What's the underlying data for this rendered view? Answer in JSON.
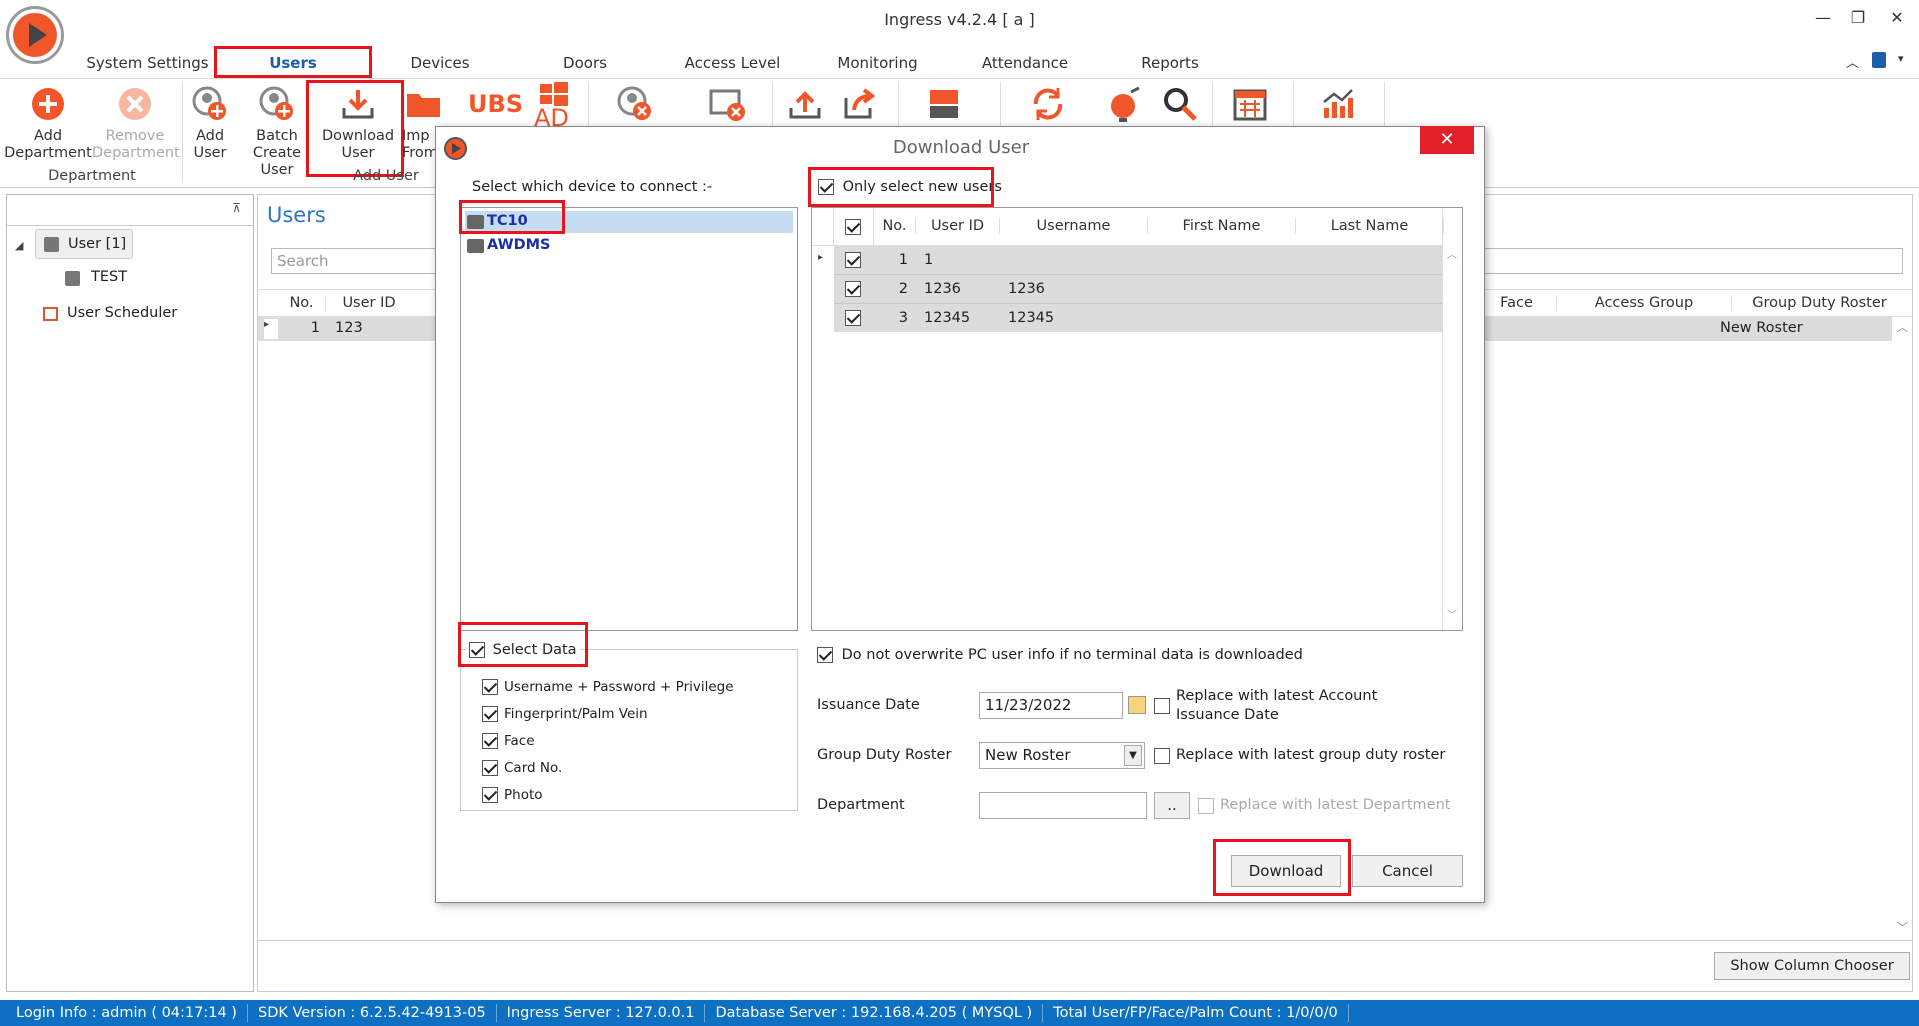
{
  "window": {
    "title": "Ingress v4.2.4 [ a ]",
    "controls": [
      "—",
      "❐",
      "✕"
    ]
  },
  "tabs": [
    "System Settings",
    "Users",
    "Devices",
    "Doors",
    "Access Level",
    "Monitoring",
    "Attendance",
    "Reports"
  ],
  "active_tab": "Users",
  "ribbon": {
    "add_department": [
      "Add",
      "Department"
    ],
    "remove_department": [
      "Remove",
      "Department"
    ],
    "department_group": "Department",
    "add_user": [
      "Add",
      "User"
    ],
    "batch_create_user": [
      "Batch",
      "Create User"
    ],
    "download_user": [
      "Download",
      "User"
    ],
    "import_from": [
      "Imp",
      "From"
    ],
    "add_user_group": "Add User",
    "ubs": "UBS",
    "ad": "AD"
  },
  "colors": {
    "accent": "#1a5fa8",
    "orange": "#f0562a",
    "highlight": "#e8141b",
    "statusbar": "#0e70c3"
  },
  "left_panel": {
    "pin": "⊼",
    "tree_user": "User [1]",
    "tree_test": "TEST",
    "tree_scheduler": "User Scheduler"
  },
  "main": {
    "title": "Users",
    "search_placeholder": "Search",
    "columns_left": [
      "No.",
      "User ID"
    ],
    "columns_right": [
      "Face",
      "Access Group",
      "Group Duty Roster"
    ],
    "row": {
      "no": "1",
      "user_id": "123",
      "roster": "New Roster"
    },
    "show_column_chooser": "Show Column Chooser"
  },
  "dialog": {
    "title": "Download User",
    "select_device_label": "Select which device to connect :-",
    "devices": [
      "TC10",
      "AWDMS"
    ],
    "only_new_users": "Only select new users",
    "grid_headers": [
      "No.",
      "User ID",
      "Username",
      "First Name",
      "Last Name"
    ],
    "grid_rows": [
      {
        "no": "1",
        "user_id": "1",
        "username": ""
      },
      {
        "no": "2",
        "user_id": "1236",
        "username": "1236"
      },
      {
        "no": "3",
        "user_id": "12345",
        "username": "12345"
      }
    ],
    "select_data": "Select Data",
    "data_options": [
      "Username + Password + Privilege",
      "Fingerprint/Palm Vein",
      "Face",
      "Card No.",
      "Photo"
    ],
    "no_overwrite": "Do not overwrite PC user info if no terminal data is downloaded",
    "issuance_date_label": "Issuance Date",
    "issuance_date": "11/23/2022",
    "replace_issuance": "Replace with latest Account Issuance Date",
    "roster_label": "Group Duty Roster",
    "roster_value": "New Roster",
    "replace_roster": "Replace with latest group duty roster",
    "department_label": "Department",
    "browse": "..",
    "replace_department": "Replace with latest Department",
    "download": "Download",
    "cancel": "Cancel"
  },
  "status": {
    "login": "Login Info : admin ( 04:17:14 )",
    "sdk": "SDK Version : 6.2.5.42-4913-05",
    "server": "Ingress Server : 127.0.0.1",
    "db": "Database Server : 192.168.4.205 ( MYSQL )",
    "total": "Total User/FP/Face/Palm Count : 1/0/0/0"
  }
}
